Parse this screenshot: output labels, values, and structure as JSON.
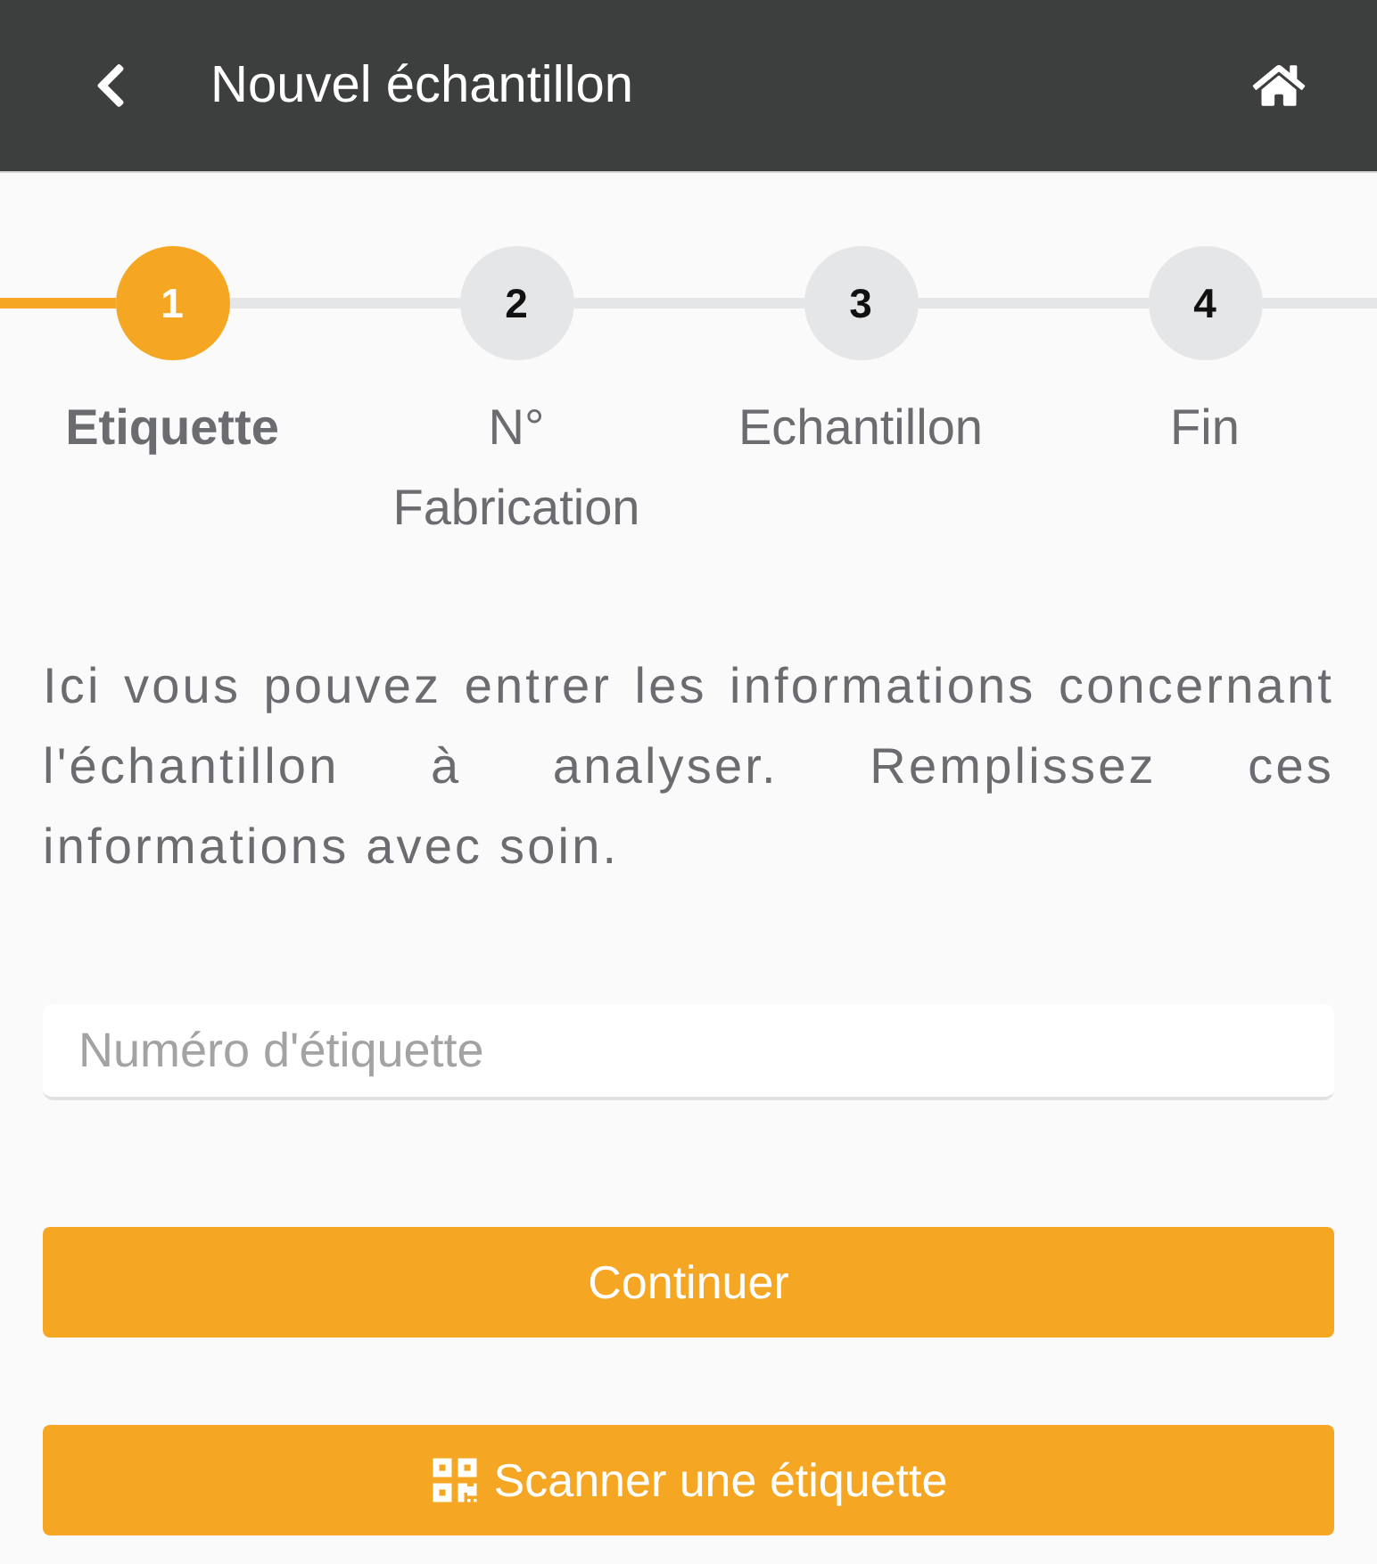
{
  "header": {
    "title": "Nouvel échantillon"
  },
  "steps": [
    {
      "number": "1",
      "label": "Etiquette",
      "selected": true
    },
    {
      "number": "2",
      "label": "N° Fabrication",
      "selected": false
    },
    {
      "number": "3",
      "label": "Echantillon",
      "selected": false
    },
    {
      "number": "4",
      "label": "Fin",
      "selected": false
    }
  ],
  "intro": "Ici vous pouvez entrer les informations concernant l'échantillon à analyser. Remplissez ces informations avec soin.",
  "label_field": {
    "placeholder": "Numéro d'étiquette"
  },
  "buttons": [
    {
      "kind": "primary",
      "label": "Continuer"
    },
    {
      "kind": "scan",
      "label": "Scanner une étiquette"
    }
  ]
}
